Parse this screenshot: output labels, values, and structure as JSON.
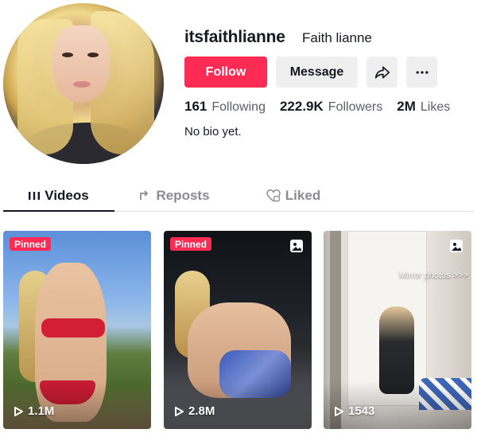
{
  "profile": {
    "username": "itsfaithlianne",
    "nickname": "Faith lianne",
    "bio": "No bio yet."
  },
  "actions": {
    "follow_label": "Follow",
    "message_label": "Message",
    "share_icon": "share-icon",
    "more_icon": "more-icon"
  },
  "stats": [
    {
      "value": "161",
      "label": "Following"
    },
    {
      "value": "222.9K",
      "label": "Followers"
    },
    {
      "value": "2M",
      "label": "Likes"
    }
  ],
  "tabs": [
    {
      "label": "Videos",
      "icon": "grid-icon",
      "active": true
    },
    {
      "label": "Reposts",
      "icon": "repost-icon",
      "active": false
    },
    {
      "label": "Liked",
      "icon": "heart-icon",
      "active": false
    }
  ],
  "videos": [
    {
      "badge": "Pinned",
      "views": "1.1M",
      "type": "video"
    },
    {
      "badge": "Pinned",
      "views": "2.8M",
      "type": "photo"
    },
    {
      "caption": "Mirror photos >>>",
      "views": "1543",
      "type": "photo"
    }
  ],
  "colors": {
    "accent": "#fe2c55",
    "text": "#161823",
    "muted": "#5c5e66",
    "button_bg": "#efefef"
  }
}
